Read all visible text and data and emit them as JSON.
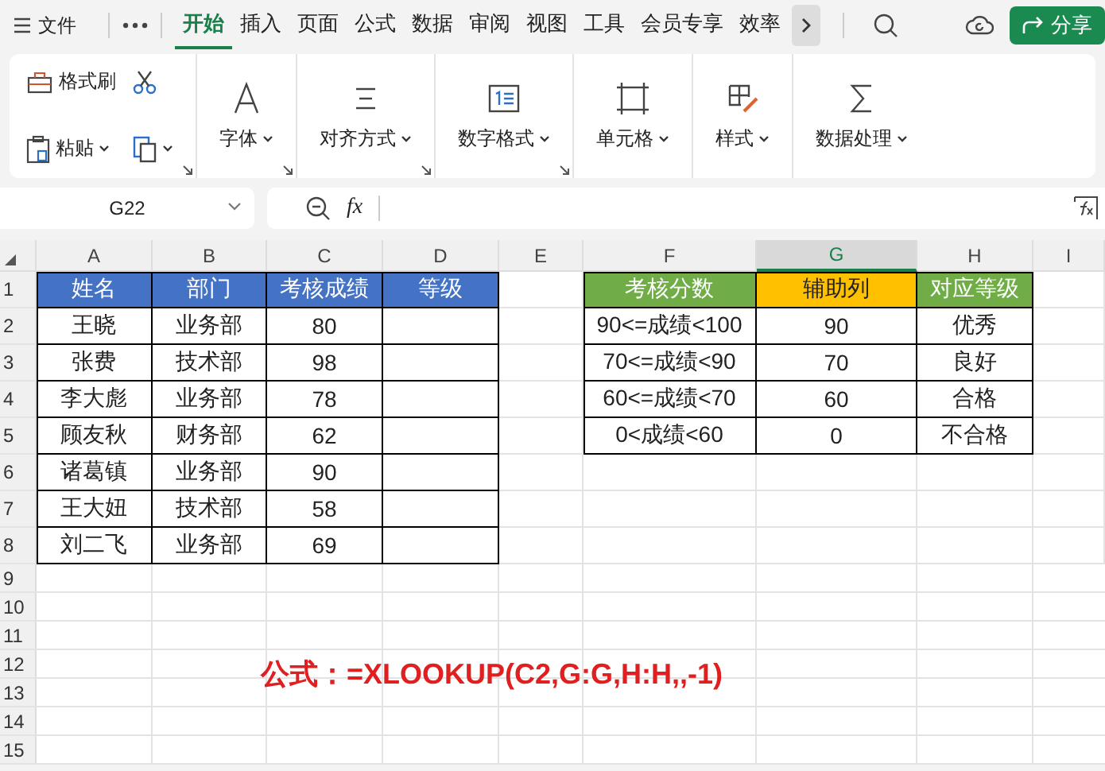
{
  "top_bar": {
    "file_label": "文件",
    "tabs": [
      {
        "label": "开始",
        "selected": true
      },
      {
        "label": "插入",
        "selected": false
      },
      {
        "label": "页面",
        "selected": false
      },
      {
        "label": "公式",
        "selected": false
      },
      {
        "label": "数据",
        "selected": false
      },
      {
        "label": "审阅",
        "selected": false
      },
      {
        "label": "视图",
        "selected": false
      },
      {
        "label": "工具",
        "selected": false
      },
      {
        "label": "会员专享",
        "selected": false
      },
      {
        "label": "效率",
        "selected": false
      }
    ],
    "share_label": "分享"
  },
  "ribbon": {
    "clipboard": {
      "format_painter": "格式刷",
      "paste": "粘贴"
    },
    "groups": [
      {
        "kind": "font",
        "label": "字体",
        "launcher": true
      },
      {
        "kind": "align",
        "label": "对齐方式",
        "launcher": true
      },
      {
        "kind": "number",
        "label": "数字格式",
        "launcher": true
      },
      {
        "kind": "cell",
        "label": "单元格",
        "launcher": false
      },
      {
        "kind": "style",
        "label": "样式",
        "launcher": false
      },
      {
        "kind": "sum",
        "label": "数据处理",
        "launcher": false
      }
    ]
  },
  "formula_bar": {
    "name_box": "G22",
    "fx_label": "fx"
  },
  "sheet": {
    "columns": [
      {
        "label": "A",
        "selected": false
      },
      {
        "label": "B",
        "selected": false
      },
      {
        "label": "C",
        "selected": false
      },
      {
        "label": "D",
        "selected": false
      },
      {
        "label": "E",
        "selected": false
      },
      {
        "label": "F",
        "selected": false
      },
      {
        "label": "G",
        "selected": true
      },
      {
        "label": "H",
        "selected": false
      },
      {
        "label": "I",
        "selected": false
      }
    ],
    "rows": [
      {
        "number": "1",
        "cells": [
          {
            "text": "姓名",
            "kind": "blue-head"
          },
          {
            "text": "部门",
            "kind": "blue-head"
          },
          {
            "text": "考核成绩",
            "kind": "blue-head"
          },
          {
            "text": "等级",
            "kind": "blue-head"
          },
          {
            "kind": "empty"
          },
          {
            "text": "考核分数",
            "kind": "green-head"
          },
          {
            "text": "辅助列",
            "kind": "gold-head"
          },
          {
            "text": "对应等级",
            "kind": "green-head"
          },
          {
            "kind": "empty"
          }
        ]
      },
      {
        "number": "2",
        "cells": [
          {
            "text": "王晓",
            "kind": "boxed"
          },
          {
            "text": "业务部",
            "kind": "boxed"
          },
          {
            "text": "80",
            "kind": "boxed"
          },
          {
            "kind": "boxed"
          },
          {
            "kind": "empty"
          },
          {
            "text": "90<=成绩<100",
            "kind": "boxed"
          },
          {
            "text": "90",
            "kind": "boxed"
          },
          {
            "text": "优秀",
            "kind": "boxed"
          },
          {
            "kind": "empty"
          }
        ]
      },
      {
        "number": "3",
        "cells": [
          {
            "text": "张费",
            "kind": "boxed"
          },
          {
            "text": "技术部",
            "kind": "boxed"
          },
          {
            "text": "98",
            "kind": "boxed"
          },
          {
            "kind": "boxed"
          },
          {
            "kind": "empty"
          },
          {
            "text": "70<=成绩<90",
            "kind": "boxed"
          },
          {
            "text": "70",
            "kind": "boxed"
          },
          {
            "text": "良好",
            "kind": "boxed"
          },
          {
            "kind": "empty"
          }
        ]
      },
      {
        "number": "4",
        "cells": [
          {
            "text": "李大彪",
            "kind": "boxed"
          },
          {
            "text": "业务部",
            "kind": "boxed"
          },
          {
            "text": "78",
            "kind": "boxed"
          },
          {
            "kind": "boxed"
          },
          {
            "kind": "empty"
          },
          {
            "text": "60<=成绩<70",
            "kind": "boxed"
          },
          {
            "text": "60",
            "kind": "boxed"
          },
          {
            "text": "合格",
            "kind": "boxed"
          },
          {
            "kind": "empty"
          }
        ]
      },
      {
        "number": "5",
        "cells": [
          {
            "text": "顾友秋",
            "kind": "boxed"
          },
          {
            "text": "财务部",
            "kind": "boxed"
          },
          {
            "text": "62",
            "kind": "boxed"
          },
          {
            "kind": "boxed"
          },
          {
            "kind": "empty"
          },
          {
            "text": "0<成绩<60",
            "kind": "boxed"
          },
          {
            "text": "0",
            "kind": "boxed"
          },
          {
            "text": "不合格",
            "kind": "boxed"
          },
          {
            "kind": "empty"
          }
        ]
      },
      {
        "number": "6",
        "cells": [
          {
            "text": "诸葛镇",
            "kind": "boxed"
          },
          {
            "text": "业务部",
            "kind": "boxed"
          },
          {
            "text": "90",
            "kind": "boxed"
          },
          {
            "kind": "boxed"
          },
          {
            "kind": "empty"
          },
          {
            "kind": "empty"
          },
          {
            "kind": "empty"
          },
          {
            "kind": "empty"
          },
          {
            "kind": "empty"
          }
        ]
      },
      {
        "number": "7",
        "cells": [
          {
            "text": "王大妞",
            "kind": "boxed"
          },
          {
            "text": "技术部",
            "kind": "boxed"
          },
          {
            "text": "58",
            "kind": "boxed"
          },
          {
            "kind": "boxed"
          },
          {
            "kind": "empty"
          },
          {
            "kind": "empty"
          },
          {
            "kind": "empty"
          },
          {
            "kind": "empty"
          },
          {
            "kind": "empty"
          }
        ]
      },
      {
        "number": "8",
        "cells": [
          {
            "text": "刘二飞",
            "kind": "boxed"
          },
          {
            "text": "业务部",
            "kind": "boxed"
          },
          {
            "text": "69",
            "kind": "boxed"
          },
          {
            "kind": "boxed"
          },
          {
            "kind": "empty"
          },
          {
            "kind": "empty"
          },
          {
            "kind": "empty"
          },
          {
            "kind": "empty"
          },
          {
            "kind": "empty"
          }
        ]
      },
      {
        "number": "9",
        "cells": []
      },
      {
        "number": "10",
        "cells": []
      },
      {
        "number": "11",
        "cells": []
      },
      {
        "number": "12",
        "cells": []
      },
      {
        "number": "13",
        "cells": []
      },
      {
        "number": "14",
        "cells": []
      },
      {
        "number": "15",
        "cells": []
      }
    ],
    "note": "公式：=XLOOKUP(C2,G:G,H:H,,-1)"
  }
}
